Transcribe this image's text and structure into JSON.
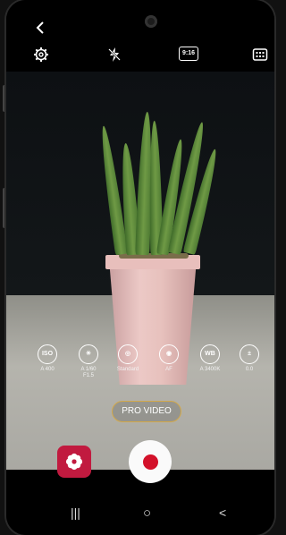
{
  "status_bar": {
    "back_icon": "chevron-left-icon"
  },
  "top_toolbar": {
    "settings_icon": "gear-icon",
    "flash_icon": "flash-off-icon",
    "ratio_label": "9:16",
    "menu_icon": "grid-icon"
  },
  "pro_controls": [
    {
      "icon_text": "ISO",
      "label": "A 400"
    },
    {
      "icon_text": "☀",
      "label": "A 1/60\nF1.5"
    },
    {
      "icon_text": "◎",
      "label": "Standard"
    },
    {
      "icon_text": "◉",
      "label": "AF"
    },
    {
      "icon_text": "WB",
      "label": "A 3400K"
    },
    {
      "icon_text": "±",
      "label": "0.0"
    }
  ],
  "mode_label": "PRO VIDEO",
  "buttons": {
    "gallery_icon": "flower-icon",
    "record_icon": "record-icon"
  },
  "nav_bar": {
    "recents": "|||",
    "home": "○",
    "back": "<"
  },
  "colors": {
    "accent_ring": "#d3a94a",
    "gallery_bg": "#c11a3f",
    "record_dot": "#d3112a"
  }
}
